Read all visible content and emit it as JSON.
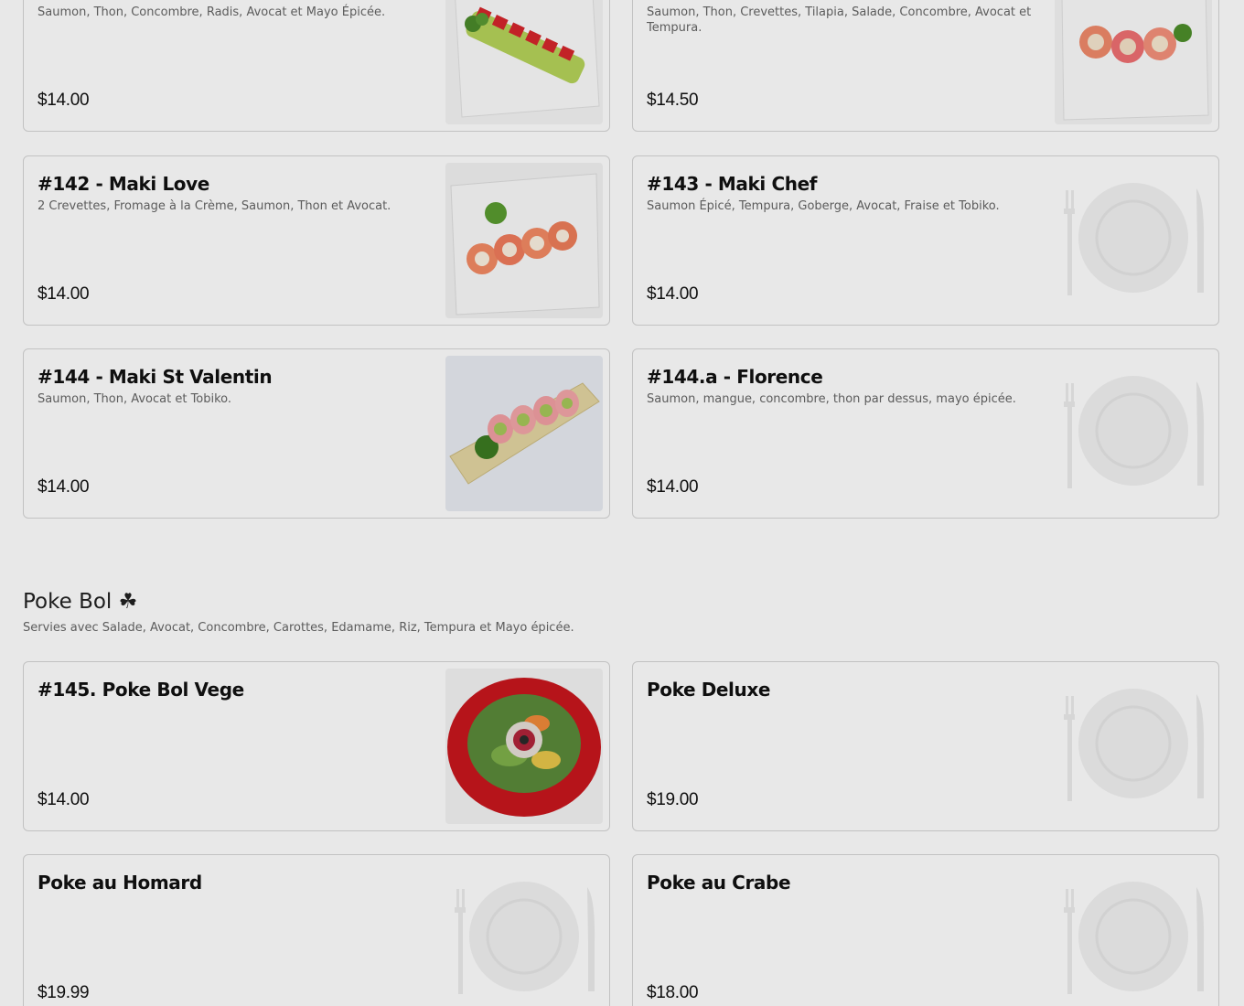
{
  "items": [
    {
      "name": "",
      "desc": "Saumon, Thon, Concombre, Radis, Avocat et Mayo Épicée.",
      "price": "$14.00"
    },
    {
      "name": "",
      "desc": "Saumon, Thon, Crevettes, Tilapia, Salade, Concombre, Avocat et Tempura.",
      "price": "$14.50"
    },
    {
      "name": "#142 - Maki Love",
      "desc": "2 Crevettes, Fromage à la Crème, Saumon, Thon et Avocat.",
      "price": "$14.00"
    },
    {
      "name": "#143 - Maki Chef",
      "desc": "Saumon Épicé, Tempura, Goberge, Avocat, Fraise et Tobiko.",
      "price": "$14.00"
    },
    {
      "name": "#144 - Maki St Valentin",
      "desc": "Saumon, Thon, Avocat et Tobiko.",
      "price": "$14.00"
    },
    {
      "name": "#144.a - Florence",
      "desc": "Saumon, mangue, concombre, thon par dessus, mayo épicée.",
      "price": "$14.00"
    },
    {
      "name": "#145. Poke Bol Vege",
      "desc": "",
      "price": "$14.00"
    },
    {
      "name": "Poke Deluxe",
      "desc": "",
      "price": "$19.00"
    },
    {
      "name": "Poke au Homard",
      "desc": "",
      "price": "$19.99"
    },
    {
      "name": "Poke au Crabe",
      "desc": "",
      "price": "$18.00"
    }
  ],
  "section": {
    "title": "Poke Bol ☘",
    "subtitle": "Servies avec Salade, Avocat, Concombre, Carottes, Edamame, Riz, Tempura et Mayo épicée."
  },
  "images": {
    "item0": "maki-roll-photo",
    "item1": "maki-roll-photo",
    "item2": "maki-roll-photo",
    "item3": "placeholder-plate-icon",
    "item4": "maki-roll-photo",
    "item5": "placeholder-plate-icon",
    "item6": "poke-bowl-photo",
    "item7": "placeholder-plate-icon",
    "item8": "placeholder-plate-icon",
    "item9": "placeholder-plate-icon"
  },
  "colors": {
    "overlay": "#000000",
    "card_border": "#d6d6d6",
    "bowl_red": "#c8161d"
  }
}
